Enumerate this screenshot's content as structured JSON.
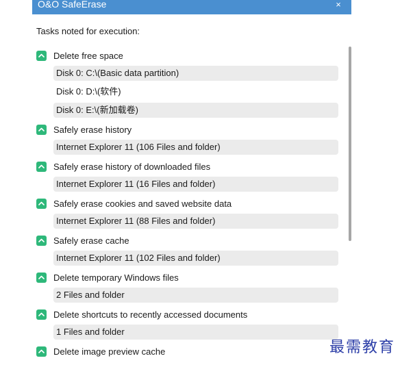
{
  "window": {
    "title": "O&O SafeErase",
    "close_glyph": "×"
  },
  "header": "Tasks noted for execution:",
  "categories": [
    {
      "label": "Delete free space",
      "icon": "chevron-up-icon",
      "items": [
        "Disk 0: C:\\(Basic data partition)",
        "Disk 0: D:\\(软件)",
        "Disk 0: E:\\(新加载卷)"
      ]
    },
    {
      "label": "Safely erase history",
      "icon": "chevron-up-icon",
      "items": [
        "Internet Explorer 11 (106 Files and folder)"
      ]
    },
    {
      "label": "Safely erase history of downloaded files",
      "icon": "chevron-up-icon",
      "items": [
        "Internet Explorer 11 (16 Files and folder)"
      ]
    },
    {
      "label": "Safely erase cookies and saved website data",
      "icon": "chevron-up-icon",
      "items": [
        "Internet Explorer 11 (88 Files and folder)"
      ]
    },
    {
      "label": "Safely erase cache",
      "icon": "chevron-up-icon",
      "items": [
        "Internet Explorer 11 (102 Files and folder)"
      ]
    },
    {
      "label": "Delete temporary Windows files",
      "icon": "chevron-up-icon",
      "items": [
        "2 Files and folder"
      ]
    },
    {
      "label": "Delete shortcuts to recently accessed documents",
      "icon": "chevron-up-icon",
      "items": [
        "1 Files and folder"
      ]
    },
    {
      "label": "Delete image preview cache",
      "icon": "chevron-up-icon",
      "items": []
    }
  ],
  "watermark": "最需教育",
  "colors": {
    "titlebar": "#4a8fd0",
    "accent": "#2eb87a",
    "row_shade": "#ebebeb"
  }
}
